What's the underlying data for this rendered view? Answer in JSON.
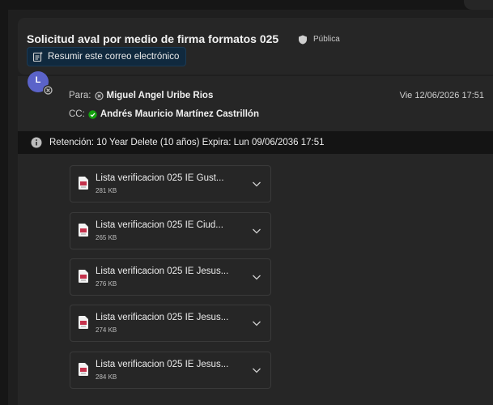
{
  "email": {
    "subject": "Solicitud aval por medio de firma formatos 025",
    "visibility": "Pública",
    "summarize_label": "Resumir este correo electrónico",
    "avatar_initial": "L",
    "to_label": "Para:",
    "to_name": "Miguel Angel Uribe Rios",
    "cc_label": "CC:",
    "cc_name": "Andrés Mauricio Martínez Castrillón",
    "date": "Vie 12/06/2026 17:51",
    "retention": "Retención: 10 Year Delete (10 años) Expira: Lun 09/06/2036 17:51"
  },
  "attachments": [
    {
      "name": "Lista verificacion 025 IE Gust...",
      "size": "281 KB"
    },
    {
      "name": "Lista verificacion 025 IE Ciud...",
      "size": "265 KB"
    },
    {
      "name": "Lista verificacion 025 IE Jesus...",
      "size": "276 KB"
    },
    {
      "name": "Lista verificacion 025 IE Jesus...",
      "size": "274 KB"
    },
    {
      "name": "Lista verificacion 025 IE Jesus...",
      "size": "284 KB"
    }
  ],
  "colors": {
    "background": "#1f1f1f",
    "panel": "#262626",
    "summarize_bg": "#10293e",
    "avatar": "#5b63c9",
    "accepted_green": "#13a10e",
    "pdf_red": "#c4314b"
  },
  "icons": [
    "shield-icon",
    "summarize-icon",
    "declined-icon",
    "accepted-icon",
    "info-icon",
    "pdf-file-icon",
    "chevron-down-icon"
  ]
}
